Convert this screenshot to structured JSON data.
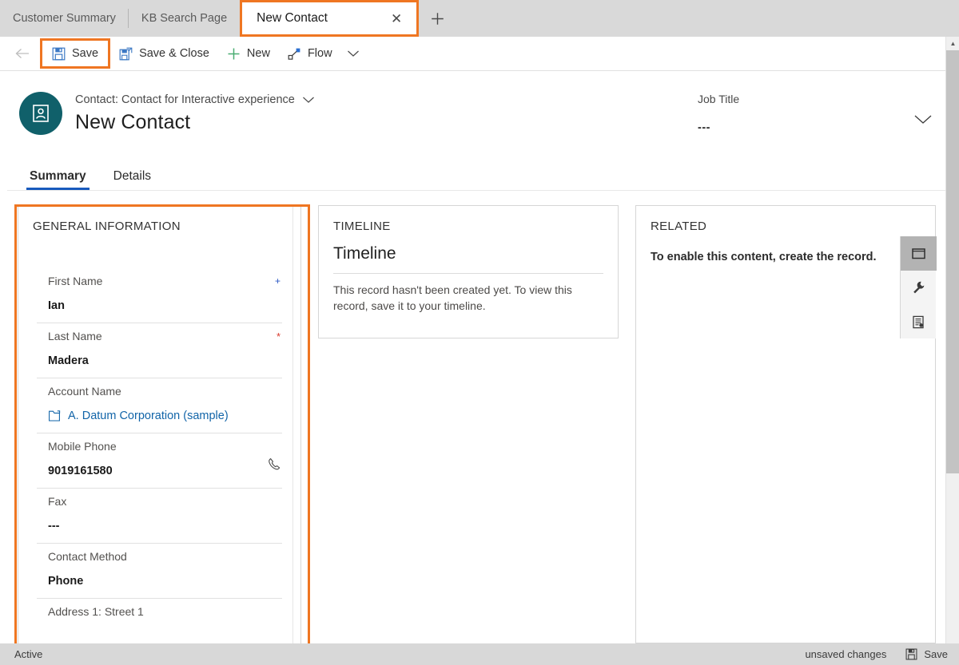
{
  "tabs": {
    "items": [
      {
        "label": "Customer Summary",
        "active": false
      },
      {
        "label": "KB Search Page",
        "active": false
      },
      {
        "label": "New Contact",
        "active": true
      }
    ],
    "close_glyph": "✕",
    "new_tab_name": "new-tab-button"
  },
  "commandbar": {
    "back_name": "back-arrow-icon",
    "buttons": [
      {
        "label": "Save",
        "icon": "save-disk-icon",
        "highlighted": true
      },
      {
        "label": "Save & Close",
        "icon": "save-and-close-icon",
        "highlighted": false
      },
      {
        "label": "New",
        "icon": "plus-icon",
        "highlighted": false
      },
      {
        "label": "Flow",
        "icon": "flow-icon",
        "highlighted": false
      }
    ],
    "overflow_label": "⌄"
  },
  "record_header": {
    "avatar_icon": "contact-avatar-icon",
    "subtitle": "Contact: Contact for Interactive experience",
    "title": "New Contact",
    "job_title_label": "Job Title",
    "job_title_value": "---"
  },
  "form_tabs": [
    {
      "label": "Summary",
      "active": true
    },
    {
      "label": "Details",
      "active": false
    }
  ],
  "general_information": {
    "heading": "GENERAL INFORMATION",
    "fields": [
      {
        "label": "First Name",
        "value": "Ian",
        "required": "recommended",
        "type": "text"
      },
      {
        "label": "Last Name",
        "value": "Madera",
        "required": "required",
        "type": "text"
      },
      {
        "label": "Account Name",
        "value": "A. Datum Corporation (sample)",
        "required": "none",
        "type": "lookup"
      },
      {
        "label": "Mobile Phone",
        "value": "9019161580",
        "required": "none",
        "type": "phone"
      },
      {
        "label": "Fax",
        "value": "---",
        "required": "none",
        "type": "text"
      },
      {
        "label": "Contact Method",
        "value": "Phone",
        "required": "none",
        "type": "optionset"
      },
      {
        "label": "Address 1: Street 1",
        "value": "",
        "required": "none",
        "type": "text"
      }
    ]
  },
  "timeline": {
    "heading": "TIMELINE",
    "title": "Timeline",
    "empty_message": "This record hasn't been created yet.  To view this record, save it to your timeline."
  },
  "related": {
    "heading": "RELATED",
    "message": "To enable this content, create the record.",
    "rail": [
      {
        "icon": "window-panel-icon",
        "selected": true
      },
      {
        "icon": "wrench-icon",
        "selected": false
      },
      {
        "icon": "report-document-icon",
        "selected": false
      }
    ]
  },
  "statusbar": {
    "left": "Active",
    "unsaved": "unsaved changes",
    "save_label": "Save",
    "save_icon": "save-disk-icon"
  },
  "colors": {
    "highlight": "#ef7622",
    "accent_tab_underline": "#185abd",
    "avatar_bg": "#10606a",
    "link": "#1164a8",
    "required_red": "#d9382b",
    "recommended_blue": "#2b57c4"
  }
}
